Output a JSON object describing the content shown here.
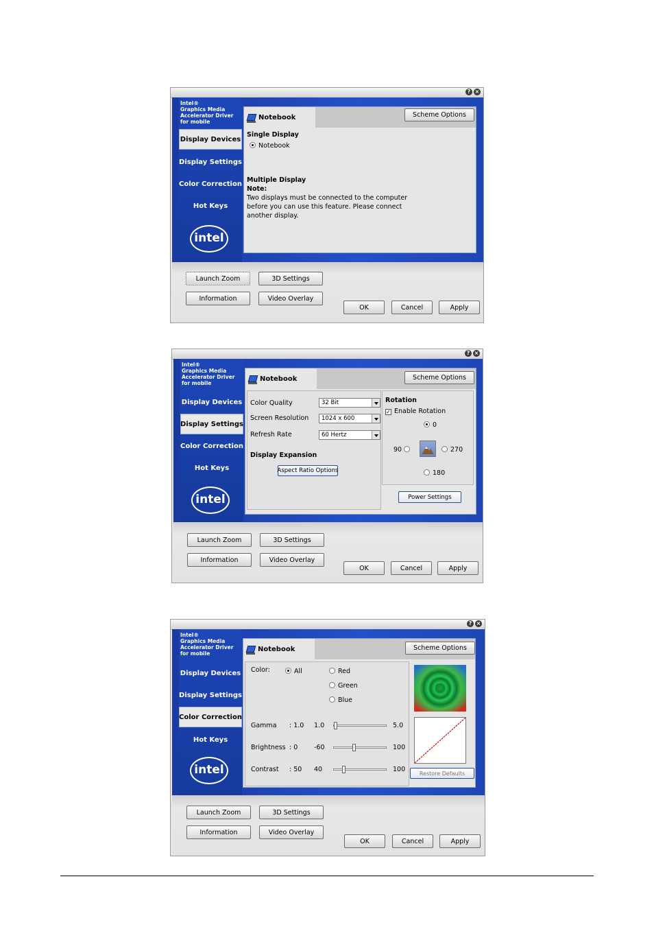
{
  "brand": {
    "line1": "Intel®",
    "line2": "Graphics Media",
    "line3": "Accelerator Driver",
    "line4": "for mobile",
    "logo": "intel"
  },
  "nav": [
    "Display Devices",
    "Display Settings",
    "Color Correction",
    "Hot Keys"
  ],
  "titlebar": {
    "help": "?",
    "close": "×"
  },
  "tab_label": "Notebook",
  "scheme_options": "Scheme Options",
  "bottom_buttons": {
    "launch_zoom": "Launch Zoom",
    "settings_3d": "3D Settings",
    "information": "Information",
    "video_overlay": "Video Overlay",
    "ok": "OK",
    "cancel": "Cancel",
    "apply": "Apply"
  },
  "win1": {
    "single_display": "Single Display",
    "notebook_option": "Notebook",
    "multiple_display": "Multiple Display",
    "note": "Note:",
    "note_line1": "Two displays must be connected to the computer",
    "note_line2": "before you can use this feature.  Please connect",
    "note_line3": "another display."
  },
  "win2": {
    "color_quality_label": "Color Quality",
    "color_quality_value": "32 Bit",
    "screen_resolution_label": "Screen Resolution",
    "screen_resolution_value": "1024 x 600",
    "refresh_rate_label": "Refresh Rate",
    "refresh_rate_value": "60 Hertz",
    "display_expansion": "Display Expansion",
    "aspect_ratio_options": "Aspect Ratio Options",
    "rotation": "Rotation",
    "enable_rotation": "Enable Rotation",
    "r0": "0",
    "r90": "90",
    "r270": "270",
    "r180": "180",
    "power_settings": "Power Settings"
  },
  "win3": {
    "color_label": "Color:",
    "all": "All",
    "red": "Red",
    "green": "Green",
    "blue": "Blue",
    "gamma_label": "Gamma",
    "gamma_value": ": 1.0",
    "gamma_min": "1.0",
    "gamma_max": "5.0",
    "brightness_label": "Brightness",
    "brightness_value": ": 0",
    "brightness_min": "-60",
    "brightness_max": "100",
    "contrast_label": "Contrast",
    "contrast_value": ": 50",
    "contrast_min": "40",
    "contrast_max": "100",
    "restore_defaults": "Restore Defaults",
    "gamma_level": 0.0,
    "brightness_level": 0.375,
    "contrast_level": 0.17
  }
}
